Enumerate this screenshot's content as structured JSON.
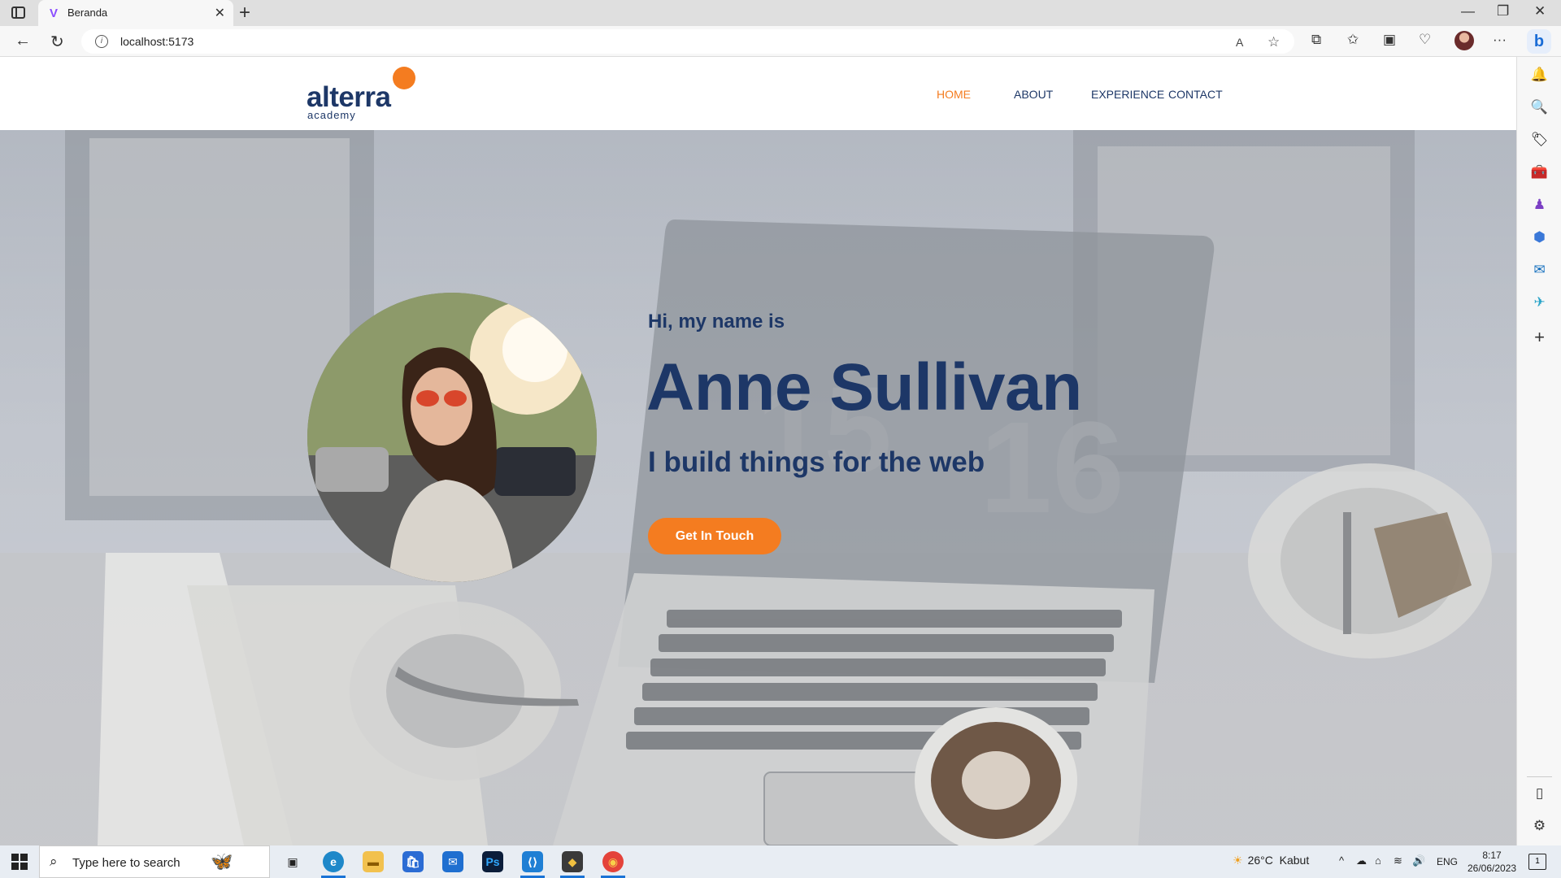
{
  "browser": {
    "tab_title": "Beranda",
    "tab_favicon": "V",
    "tab_close": "✕",
    "new_tab": "+",
    "url": "localhost:5173",
    "window_controls": {
      "minimize": "—",
      "restore": "❐",
      "close": "✕"
    },
    "icons": {
      "back": "←",
      "refresh": "↻",
      "info": "i",
      "read_aloud": "A",
      "favorite": "☆",
      "split": "⧉",
      "favorites": "✩",
      "collections": "▣",
      "extensions": "♡",
      "more": "···",
      "bing": "b"
    }
  },
  "sidebar": {
    "items": [
      {
        "name": "bell",
        "glyph": "🔔",
        "color": "#1a6cd6"
      },
      {
        "name": "search",
        "glyph": "🔍",
        "color": "#1a6cd6"
      },
      {
        "name": "shopping",
        "glyph": "🏷",
        "color": "#4a6cf0"
      },
      {
        "name": "tools",
        "glyph": "🧰",
        "color": "#d9534f"
      },
      {
        "name": "games",
        "glyph": "♟",
        "color": "#7b3fc4"
      },
      {
        "name": "microsoft365",
        "glyph": "⬢",
        "color": "#3a78d8"
      },
      {
        "name": "outlook",
        "glyph": "✉",
        "color": "#0f6cbd"
      },
      {
        "name": "drop",
        "glyph": "✈",
        "color": "#2aa4c9"
      },
      {
        "name": "add",
        "glyph": "+",
        "color": "#333333"
      }
    ],
    "bottom": {
      "panel": "▯",
      "settings": "⚙"
    }
  },
  "site": {
    "logo": {
      "word": "alterra",
      "sub": "academy"
    },
    "nav": [
      {
        "label": "HOME",
        "active": true
      },
      {
        "label": "ABOUT",
        "active": false
      },
      {
        "label": "EXPERIENCE",
        "active": false
      },
      {
        "label": "CONTACT",
        "active": false
      }
    ],
    "hero": {
      "greeting": "Hi, my name is",
      "name": "Anne Sullivan",
      "tagline": "I build things for the web",
      "cta": "Get In Touch"
    }
  },
  "taskbar": {
    "search_placeholder": "Type here to search",
    "apps": [
      {
        "name": "task-view",
        "glyph": "▣",
        "bg": "transparent",
        "fg": "#222222"
      },
      {
        "name": "edge",
        "glyph": "e",
        "bg": "#1e88c9",
        "fg": "#ffffff"
      },
      {
        "name": "file-explorer",
        "glyph": "▬",
        "bg": "#f2c14e",
        "fg": "#8a5a00"
      },
      {
        "name": "store",
        "glyph": "🛍",
        "bg": "#2b6cd4",
        "fg": "#ffffff"
      },
      {
        "name": "mail",
        "glyph": "✉",
        "bg": "#1f6fd0",
        "fg": "#ffffff"
      },
      {
        "name": "photoshop",
        "glyph": "Ps",
        "bg": "#0b1d3a",
        "fg": "#31a8ff"
      },
      {
        "name": "vscode",
        "glyph": "⟨⟩",
        "bg": "#1f7fd4",
        "fg": "#ffffff"
      },
      {
        "name": "git",
        "glyph": "◆",
        "bg": "#3a3a3a",
        "fg": "#f0c040"
      },
      {
        "name": "chrome",
        "glyph": "◉",
        "bg": "#e4433a",
        "fg": "#f8d04a"
      }
    ],
    "weather": {
      "temp": "26°C",
      "condition": "Kabut"
    },
    "tray": {
      "chevron": "^",
      "cloud": "☁",
      "network": "⌂",
      "wifi": "≋",
      "volume": "🔊",
      "lang": "ENG"
    },
    "clock": {
      "time": "8:17",
      "date": "26/06/2023"
    },
    "notifications": "1"
  }
}
